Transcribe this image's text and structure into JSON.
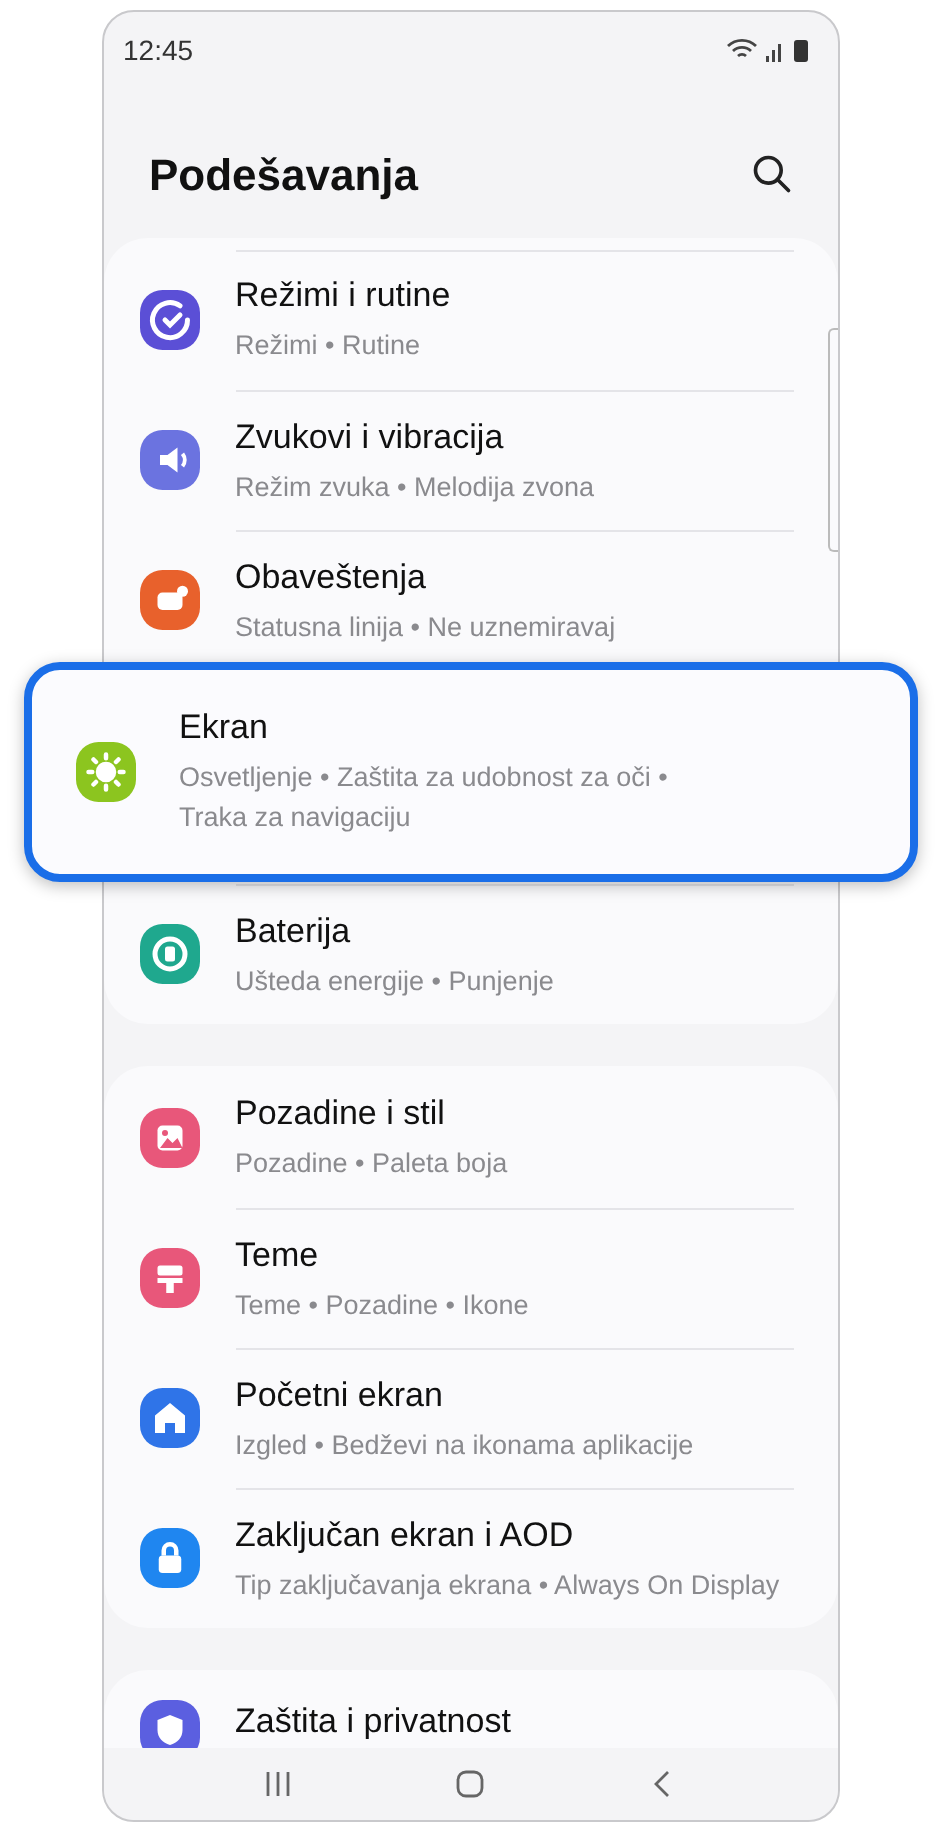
{
  "status_bar": {
    "time": "12:45"
  },
  "header": {
    "title": "Podešavanja"
  },
  "groups": [
    {
      "items": [
        {
          "title": "Režimi i rutine",
          "subtitle": "Režimi  •  Rutine",
          "color": "#5b4fd6",
          "highlighted": false
        },
        {
          "title": "Zvukovi i vibracija",
          "subtitle": "Režim zvuka  •  Melodija zvona",
          "color": "#6b73e0",
          "highlighted": false
        },
        {
          "title": "Obaveštenja",
          "subtitle": "Statusna linija  •  Ne uznemiravaj",
          "color": "#e8612c",
          "highlighted": false
        },
        {
          "title": "Ekran",
          "subtitle": "Osvetljenje  •  Zaštita za udobnost za oči  •  Traka za navigaciju",
          "color": "#8cc51f",
          "highlighted": true
        },
        {
          "title": "Baterija",
          "subtitle": "Ušteda energije  •  Punjenje",
          "color": "#1fa88e",
          "highlighted": false
        }
      ]
    },
    {
      "items": [
        {
          "title": "Pozadine i stil",
          "subtitle": "Pozadine  •  Paleta boja",
          "color": "#e8577a",
          "highlighted": false
        },
        {
          "title": "Teme",
          "subtitle": "Teme  •  Pozadine  •  Ikone",
          "color": "#e8577a",
          "highlighted": false
        },
        {
          "title": "Početni ekran",
          "subtitle": "Izgled  •  Bedževi na ikonama aplikacije",
          "color": "#2f74e8",
          "highlighted": false
        },
        {
          "title": "Zaključan ekran i AOD",
          "subtitle": "Tip zaključavanja ekrana  •  Always On Display",
          "color": "#1f86f0",
          "highlighted": false
        }
      ]
    },
    {
      "items": [
        {
          "title": "Zaštita i privatnost",
          "color": "#5b5fe0",
          "highlighted": false
        }
      ]
    }
  ]
}
